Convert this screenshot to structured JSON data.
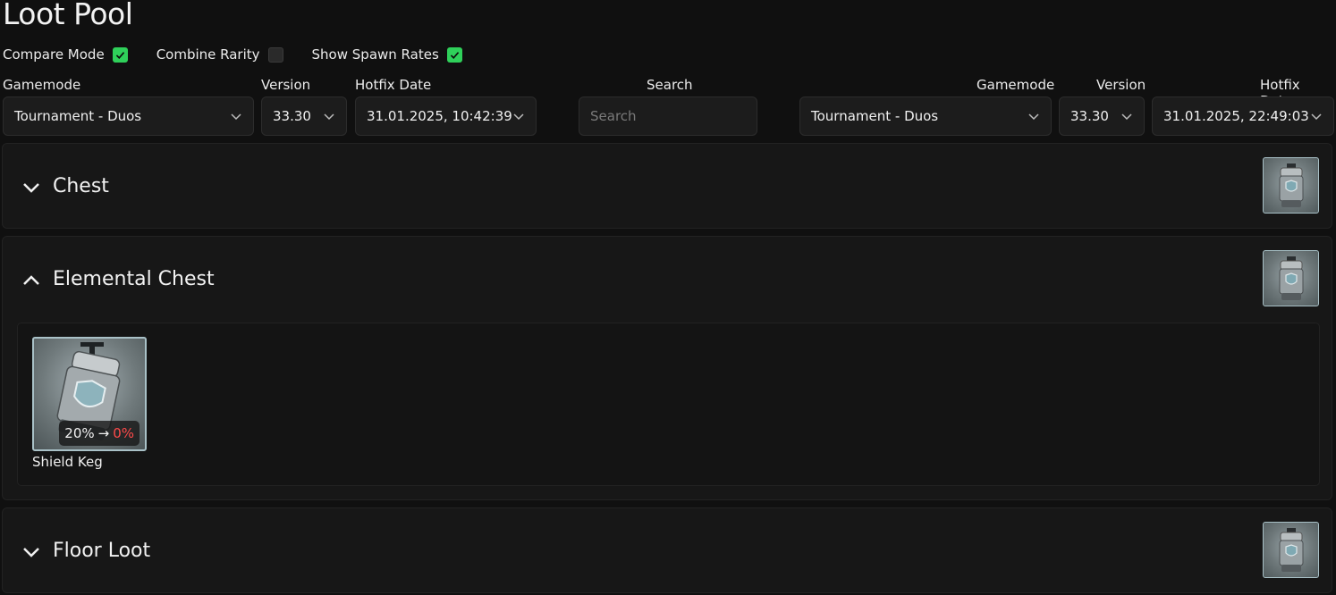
{
  "page": {
    "title": "Loot Pool"
  },
  "options": [
    {
      "label": "Compare Mode",
      "checked": true
    },
    {
      "label": "Combine Rarity",
      "checked": false
    },
    {
      "label": "Show Spawn Rates",
      "checked": true
    }
  ],
  "left": {
    "gamemode_label": "Gamemode",
    "gamemode_value": "Tournament - Duos",
    "version_label": "Version",
    "version_value": "33.30",
    "hotfix_label": "Hotfix Date",
    "hotfix_value": "31.01.2025, 10:42:39"
  },
  "search": {
    "label": "Search",
    "placeholder": "Search"
  },
  "right": {
    "gamemode_label": "Gamemode",
    "gamemode_value": "Tournament - Duos",
    "version_label": "Version",
    "version_value": "33.30",
    "hotfix_label": "Hotfix Date",
    "hotfix_value": "31.01.2025, 22:49:03"
  },
  "sections": [
    {
      "name": "Chest",
      "expanded": false
    },
    {
      "name": "Elemental Chest",
      "expanded": true,
      "items": [
        {
          "name": "Shield Keg",
          "rate_old": "20%",
          "rate_arrow": "→",
          "rate_new": "0%"
        }
      ]
    },
    {
      "name": "Floor Loot",
      "expanded": false
    }
  ],
  "icons": {
    "chevron_down": "chevron-down-icon",
    "chevron_up": "chevron-up-icon",
    "check": "check-icon",
    "keg": "shield-keg-icon"
  },
  "colors": {
    "check_green": "#2fd05a",
    "rate_decrease": "#ff4a4a",
    "item_border": "#a9c1c7"
  }
}
